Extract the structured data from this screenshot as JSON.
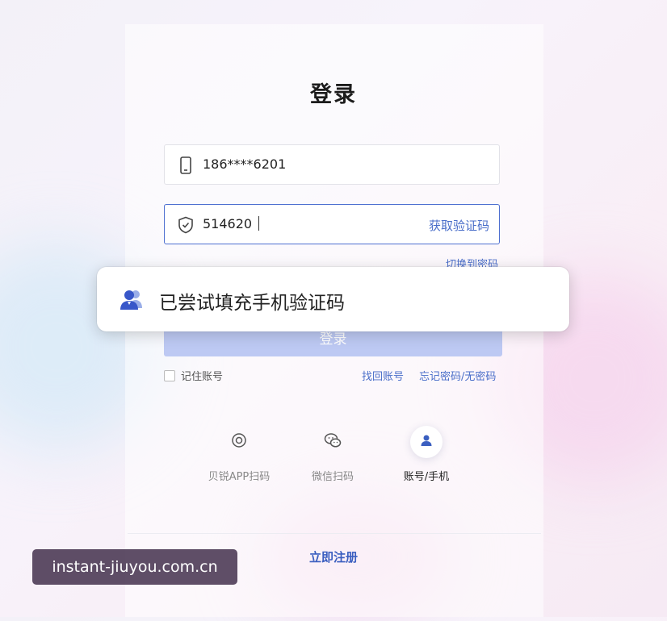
{
  "page": {
    "title": "登录"
  },
  "form": {
    "phone_value": "186****6201",
    "code_value": "514620",
    "get_code_label": "获取验证码",
    "switch_label": "切换到密码",
    "login_label": "登录",
    "remember_label": "记住账号",
    "retrieve_label": "找回账号",
    "forgot_label": "忘记密码/无密码"
  },
  "toast": {
    "text": "已尝试填充手机验证码",
    "icon": "user-group-icon"
  },
  "methods": [
    {
      "label": "贝锐APP扫码",
      "icon": "scan-icon",
      "active": false
    },
    {
      "label": "微信扫码",
      "icon": "wechat-icon",
      "active": false
    },
    {
      "label": "账号/手机",
      "icon": "user-icon",
      "active": true
    }
  ],
  "footer": {
    "register_label": "立即注册"
  },
  "watermark": {
    "text": "instant-jiuyou.com.cn"
  },
  "colors": {
    "accent": "#4a6ec9",
    "button_disabled": "#bdc9f3"
  }
}
